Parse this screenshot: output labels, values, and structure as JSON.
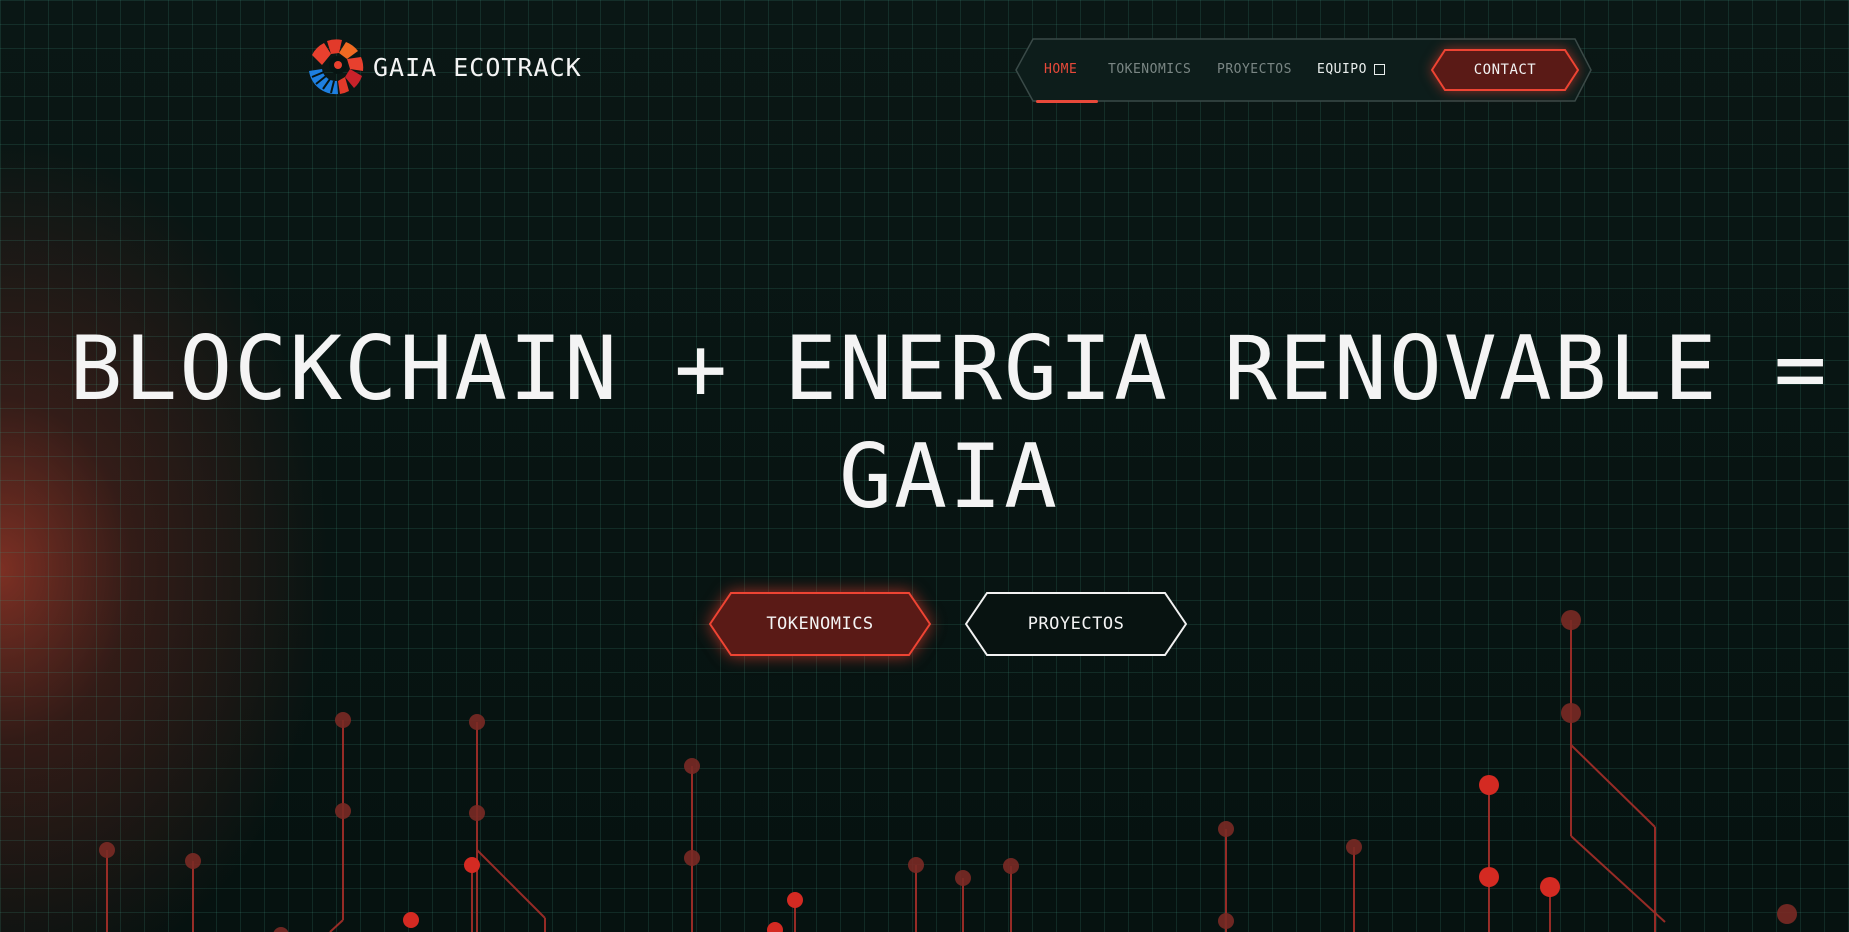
{
  "brand": {
    "name": "GAIA ECOTRACK",
    "logo_icon": "sun-globe-logo-icon",
    "colors": {
      "red": "#e23a2a",
      "orange": "#f07a22",
      "blue": "#1e7fe0"
    }
  },
  "nav": {
    "items": [
      {
        "label": "HOME",
        "active": true
      },
      {
        "label": "TOKENOMICS",
        "active": false
      },
      {
        "label": "PROYECTOS",
        "active": false
      },
      {
        "label": "EQUIPO",
        "active": false,
        "icon": "square-icon"
      }
    ],
    "contact_label": "CONTACT"
  },
  "hero": {
    "title_line1": "BLOCKCHAIN + ENERGIA RENOVABLE =",
    "title_line2": "GAIA",
    "primary_button": "TOKENOMICS",
    "secondary_button": "PROYECTOS"
  },
  "theme": {
    "background": "#071412",
    "accent": "#e8493a",
    "grid": "#1e4a42",
    "circuit": "#c8322a"
  }
}
